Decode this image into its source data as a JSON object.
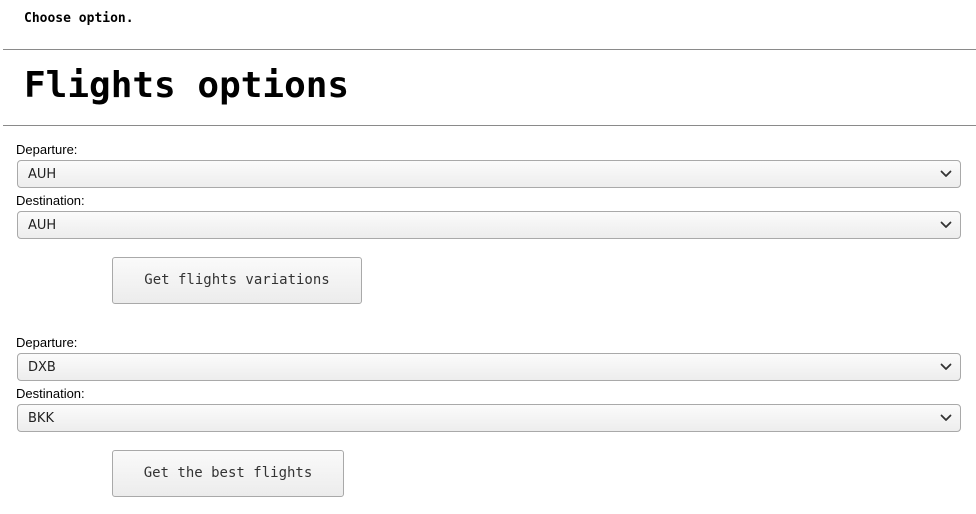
{
  "instruction": "Choose option.",
  "title": "Flights options",
  "form1": {
    "departure_label": "Departure:",
    "departure_value": "AUH",
    "destination_label": "Destination:",
    "destination_value": "AUH",
    "button_label": "Get flights variations"
  },
  "form2": {
    "departure_label": "Departure:",
    "departure_value": "DXB",
    "destination_label": "Destination:",
    "destination_value": "BKK",
    "button_label": "Get the best flights"
  },
  "icons": {
    "select_arrow": "chevron-down-icon"
  }
}
